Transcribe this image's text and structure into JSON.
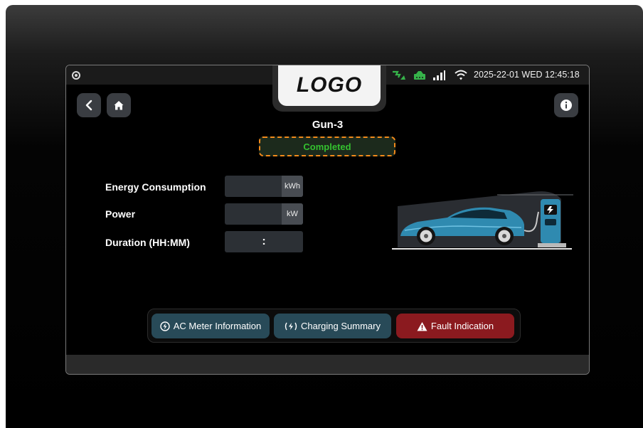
{
  "status_bar": {
    "datetime": "2025-22-01 WED 12:45:18",
    "icons": [
      "camera-icon",
      "ev-network-icon",
      "router-icon",
      "signal-bars-icon",
      "wifi-icon"
    ]
  },
  "logo": {
    "text": "LOGO"
  },
  "nav": {
    "back_icon": "chevron-left-icon",
    "home_icon": "home-icon",
    "info_icon": "info-icon"
  },
  "gun": {
    "title": "Gun-3",
    "status": "Completed"
  },
  "metrics": [
    {
      "label": "Energy Consumption",
      "value": "",
      "unit": "kWh"
    },
    {
      "label": "Power",
      "value": "",
      "unit": "kW"
    },
    {
      "label": "Duration (HH:MM)",
      "value": ":",
      "unit": ""
    }
  ],
  "actions": {
    "ac_meter": {
      "label": "AC Meter Information",
      "icon": "ac-meter-icon"
    },
    "charging_summary": {
      "label": "Charging Summary",
      "icon": "charging-icon"
    },
    "fault": {
      "label": "Fault Indication",
      "icon": "warning-icon"
    }
  },
  "colors": {
    "status_text": "#34c12f",
    "status_border": "#f28a1b",
    "teal_button": "#284a58",
    "red_button": "#8b1a1f"
  }
}
